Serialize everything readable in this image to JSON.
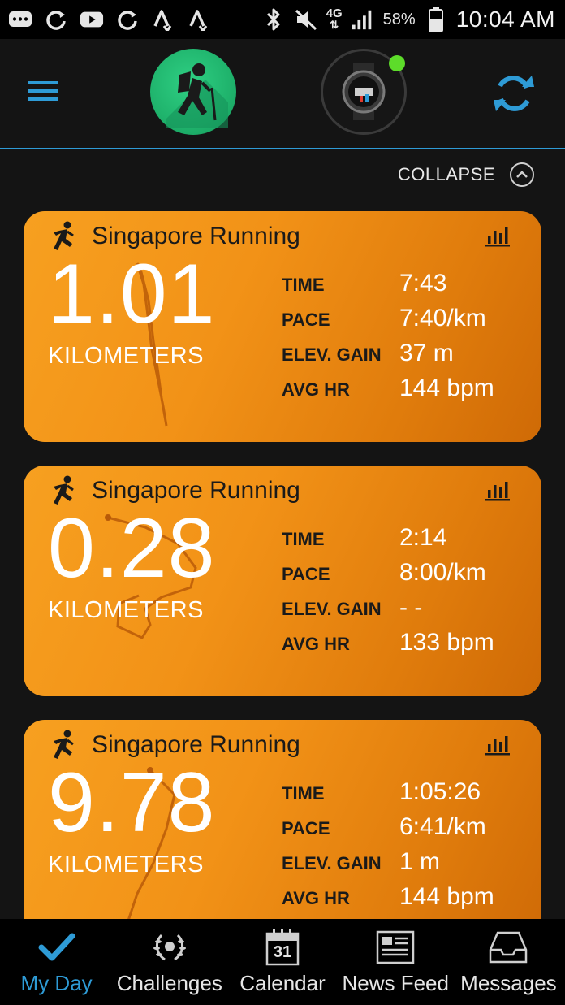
{
  "status_bar": {
    "battery": "58%",
    "time": "10:04 AM",
    "network": "4G",
    "icons": [
      "messages-icon",
      "sync-icon",
      "youtube-icon",
      "sync-icon",
      "strava-icon",
      "strava-icon",
      "bluetooth-icon",
      "mute-icon",
      "network-icon",
      "signal-icon",
      "battery-icon"
    ]
  },
  "header": {
    "avatar_icon": "hiker-icon",
    "device_icon": "watch-icon",
    "device_status_color": "#5ddc2a",
    "accent_color": "#2e9bd6"
  },
  "collapse": {
    "label": "COLLAPSE"
  },
  "activities": [
    {
      "title": "Singapore Running",
      "distance": "1.01",
      "unit": "KILOMETERS",
      "stats": [
        {
          "label": "TIME",
          "value": "7:43"
        },
        {
          "label": "PACE",
          "value": "7:40/km"
        },
        {
          "label": "ELEV. GAIN",
          "value": "37 m"
        },
        {
          "label": "AVG HR",
          "value": "144 bpm"
        }
      ]
    },
    {
      "title": "Singapore Running",
      "distance": "0.28",
      "unit": "KILOMETERS",
      "stats": [
        {
          "label": "TIME",
          "value": "2:14"
        },
        {
          "label": "PACE",
          "value": "8:00/km"
        },
        {
          "label": "ELEV. GAIN",
          "value": "- -"
        },
        {
          "label": "AVG HR",
          "value": "133 bpm"
        }
      ]
    },
    {
      "title": "Singapore Running",
      "distance": "9.78",
      "unit": "KILOMETERS",
      "stats": [
        {
          "label": "TIME",
          "value": "1:05:26"
        },
        {
          "label": "PACE",
          "value": "6:41/km"
        },
        {
          "label": "ELEV. GAIN",
          "value": "1 m"
        },
        {
          "label": "AVG HR",
          "value": "144 bpm"
        }
      ]
    }
  ],
  "nav": {
    "items": [
      {
        "label": "My Day",
        "icon": "checkmark-icon",
        "active": true
      },
      {
        "label": "Challenges",
        "icon": "laurel-icon",
        "active": false
      },
      {
        "label": "Calendar",
        "icon": "calendar-icon",
        "calendar_day": "31",
        "active": false
      },
      {
        "label": "News Feed",
        "icon": "newsfeed-icon",
        "active": false
      },
      {
        "label": "Messages",
        "icon": "inbox-icon",
        "active": false
      }
    ]
  }
}
